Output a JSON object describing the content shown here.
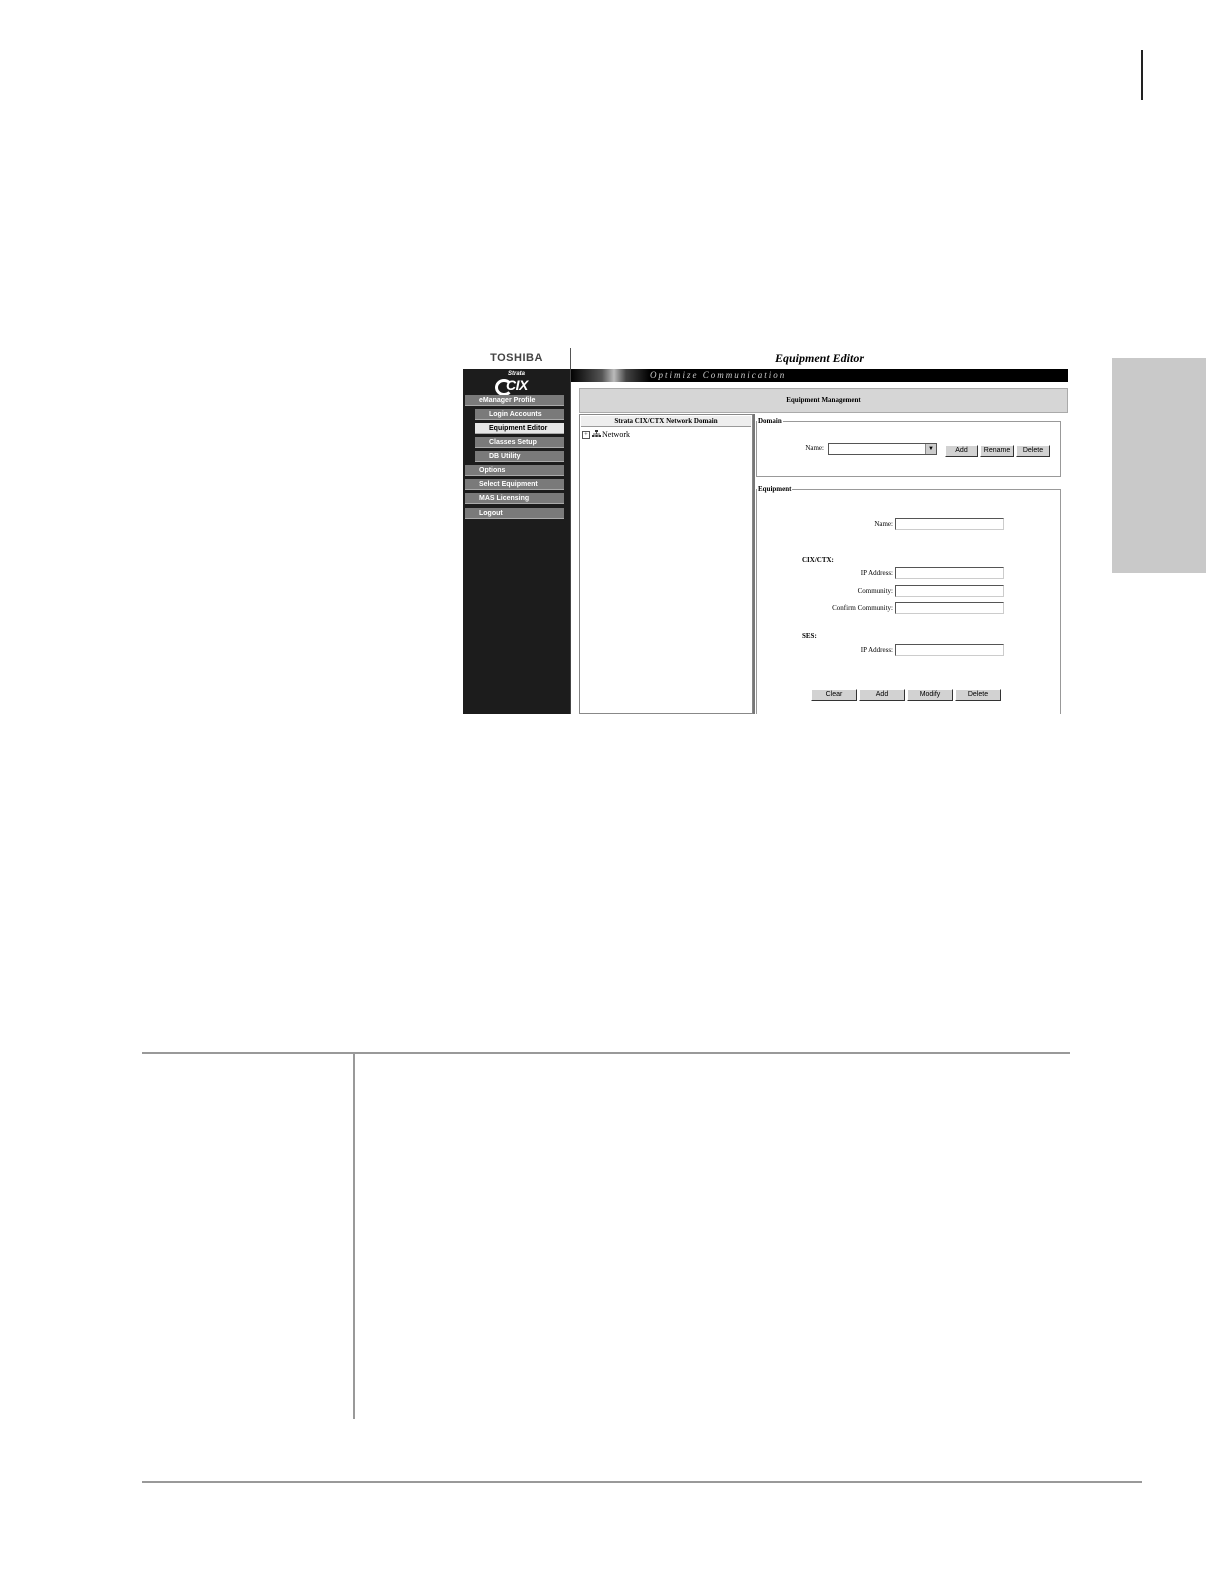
{
  "brand": "TOSHIBA",
  "page_title": "Equipment Editor",
  "logo": {
    "small": "Strata",
    "big": "CIX"
  },
  "banner_text": "Optimize Communication",
  "section_title": "Equipment Management",
  "sidebar": {
    "items": [
      {
        "label": "eManager Profile"
      },
      {
        "label": "Login Accounts"
      },
      {
        "label": "Equipment Editor"
      },
      {
        "label": "Classes Setup"
      },
      {
        "label": "DB Utility"
      },
      {
        "label": "Options"
      },
      {
        "label": "Select Equipment"
      },
      {
        "label": "MAS Licensing"
      },
      {
        "label": "Logout"
      }
    ]
  },
  "tree": {
    "header": "Strata CIX/CTX Network Domain",
    "root": {
      "expander": "+",
      "label": "Network"
    }
  },
  "domain": {
    "legend": "Domain",
    "name_label": "Name:",
    "name_value": "",
    "buttons": {
      "add": "Add",
      "rename": "Rename",
      "delete": "Delete"
    }
  },
  "equipment": {
    "legend": "Equipment",
    "name_label": "Name:",
    "cix_heading": "CIX/CTX:",
    "ip_label": "IP Address:",
    "community_label": "Community:",
    "confirm_label": "Confirm Community:",
    "ses_heading": "SES:",
    "ses_ip_label": "IP Address:",
    "buttons": {
      "clear": "Clear",
      "add": "Add",
      "modify": "Modify",
      "delete": "Delete"
    }
  },
  "colors": {
    "sidebar_bg": "#1c1c1c",
    "side_tab": "#c9c9c9"
  }
}
